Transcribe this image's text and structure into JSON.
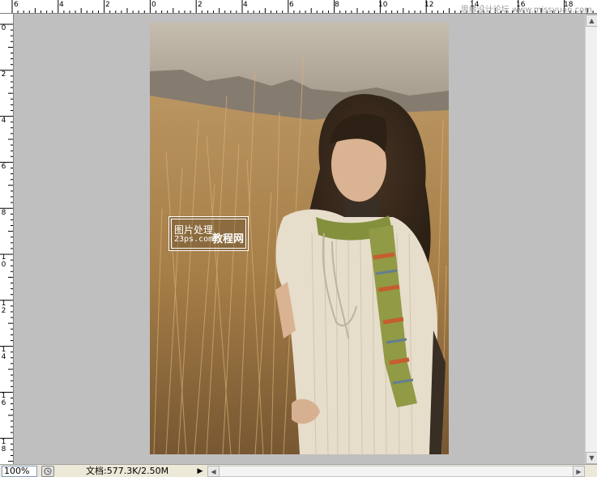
{
  "ruler_top": {
    "labels": [
      "6",
      "4",
      "2",
      "0",
      "2",
      "4",
      "6",
      "8",
      "10",
      "12",
      "14",
      "16",
      "18"
    ]
  },
  "ruler_left": {
    "labels": [
      "0",
      "2",
      "4",
      "6",
      "8",
      "1\n0",
      "1\n2",
      "1\n4",
      "1\n6",
      "1\n8"
    ]
  },
  "watermark": "思缘设计论坛 www.missyuan.com",
  "logo": {
    "line1": "图片处理",
    "line2": "23ps.com",
    "line3": "教程网"
  },
  "status": {
    "zoom": "100%",
    "doc_info": "文档:577.3K/2.50M"
  },
  "colors": {
    "workspace": "#bfbfbf",
    "statusbar": "#ece9d8"
  },
  "icons": {
    "status_menu": "triangle-right-icon",
    "scroll_up": "arrow-up-icon",
    "scroll_down": "arrow-down-icon",
    "scroll_left": "arrow-left-icon",
    "scroll_right": "arrow-right-icon"
  }
}
